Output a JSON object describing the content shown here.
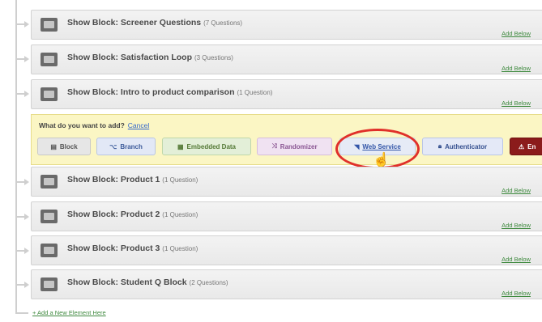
{
  "blocks_top": [
    {
      "title": "Show Block: Screener Questions",
      "count": "(7 Questions)",
      "add_below": "Add Below"
    },
    {
      "title": "Show Block: Satisfaction Loop",
      "count": "(3 Questions)",
      "add_below": "Add Below"
    },
    {
      "title": "Show Block: Intro to product comparison",
      "count": "(1 Question)",
      "add_below": "Add Below"
    }
  ],
  "add_panel": {
    "question": "What do you want to add?",
    "cancel": "Cancel",
    "options": [
      {
        "label": "Block",
        "icon": "block-icon"
      },
      {
        "label": "Branch",
        "icon": "branch-icon"
      },
      {
        "label": "Embedded Data",
        "icon": "embedded-data-icon"
      },
      {
        "label": "Randomizer",
        "icon": "randomizer-icon"
      },
      {
        "label": "Web Service",
        "icon": "web-service-icon"
      },
      {
        "label": "Authenticator",
        "icon": "lock-icon"
      },
      {
        "label": "En",
        "icon": "warning-icon"
      }
    ],
    "highlighted_option": "Web Service"
  },
  "blocks_bottom": [
    {
      "title": "Show Block: Product 1",
      "count": "(1 Question)",
      "add_below": "Add Below"
    },
    {
      "title": "Show Block: Product 2",
      "count": "(1 Question)",
      "add_below": "Add Below"
    },
    {
      "title": "Show Block: Product 3",
      "count": "(1 Question)",
      "add_below": "Add Below"
    },
    {
      "title": "Show Block: Student Q Block",
      "count": "(2 Questions)",
      "add_below": "Add Below"
    }
  ],
  "add_new_element": "+ Add a New Element Here",
  "colors": {
    "panel_bg": "#fbf6c4",
    "highlight": "#e0302a",
    "link": "#3366cc",
    "add_below": "#3f8a3f"
  }
}
